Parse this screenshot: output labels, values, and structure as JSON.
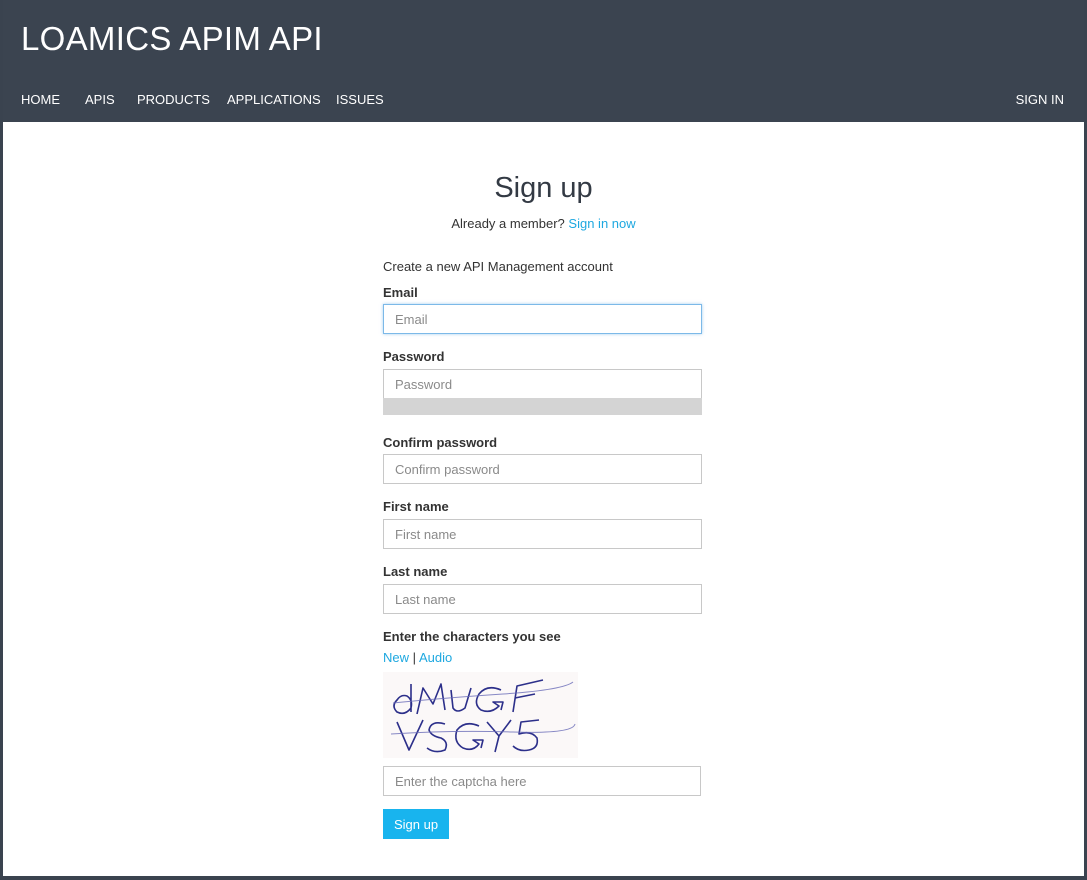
{
  "header": {
    "site_title": "LOAMICS APIM API",
    "nav": {
      "home": "HOME",
      "apis": "APIS",
      "products": "PRODUCTS",
      "applications": "APPLICATIONS",
      "issues": "ISSUES",
      "sign_in": "SIGN IN"
    }
  },
  "main": {
    "title": "Sign up",
    "member_prompt": "Already a member?",
    "sign_in_link": "Sign in now",
    "subtitle": "Create a new API Management account"
  },
  "form": {
    "email": {
      "label": "Email",
      "placeholder": "Email",
      "value": ""
    },
    "password": {
      "label": "Password",
      "placeholder": "Password",
      "value": ""
    },
    "confirm_password": {
      "label": "Confirm password",
      "placeholder": "Confirm password",
      "value": ""
    },
    "first_name": {
      "label": "First name",
      "placeholder": "First name",
      "value": ""
    },
    "last_name": {
      "label": "Last name",
      "placeholder": "Last name",
      "value": ""
    },
    "captcha": {
      "label": "Enter the characters you see",
      "new_link": "New",
      "separator": "|",
      "audio_link": "Audio",
      "image_text": "dMUGF VSGY5",
      "placeholder": "Enter the captcha here",
      "value": ""
    },
    "submit_label": "Sign up"
  },
  "colors": {
    "header_bg": "#3b4450",
    "link": "#1ea8e0",
    "primary_button": "#18b4ee"
  }
}
